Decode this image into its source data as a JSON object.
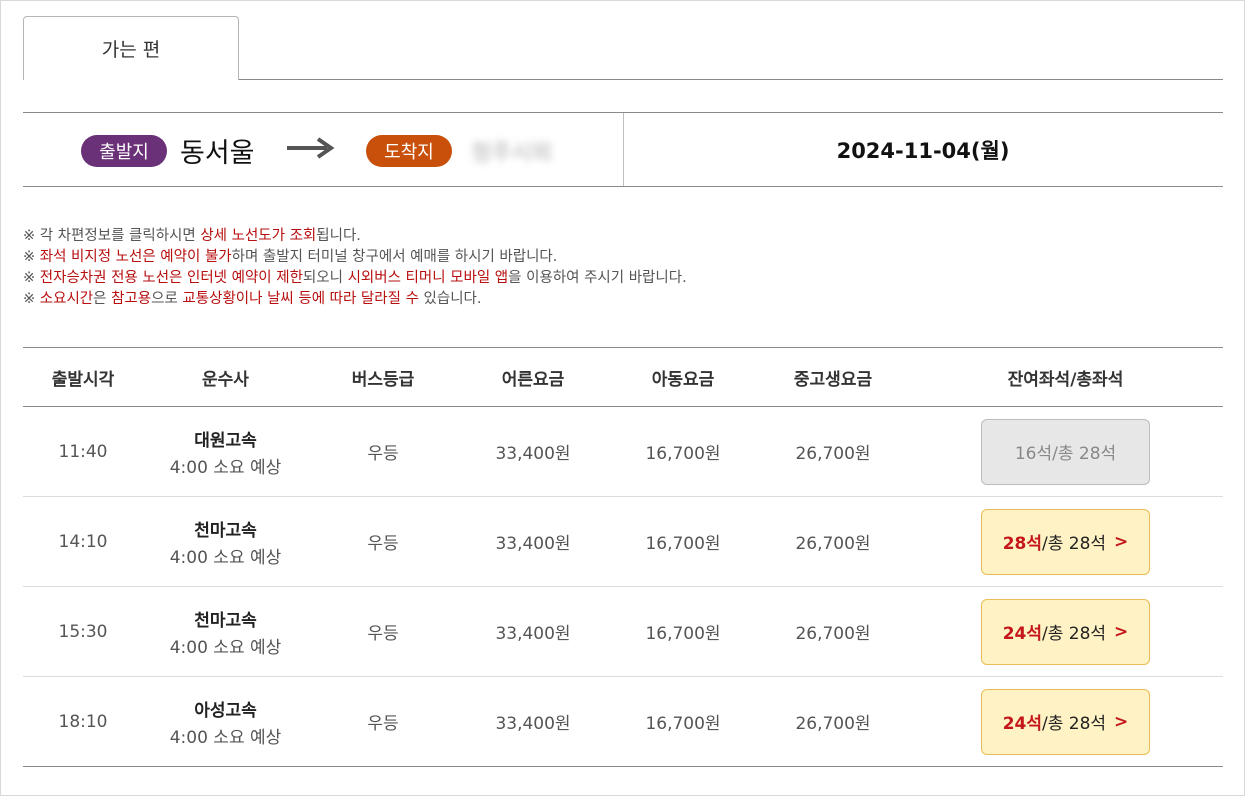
{
  "tabs": [
    {
      "label": "가는 편",
      "active": true
    }
  ],
  "route": {
    "departure_label": "출발지",
    "departure_city": "동서울",
    "arrival_label": "도착지",
    "arrival_city": "청주시외",
    "date": "2024-11-04(월)"
  },
  "notices": {
    "n1": {
      "a": "※ 각 차편정보를 클릭하시면 ",
      "b": "상세 노선도가 조회",
      "c": "됩니다."
    },
    "n2": {
      "a": "※ ",
      "b": "좌석 비지정 노선은 예약이 불가",
      "c": "하며 출발지 터미널 창구에서 예매를 하시기 바랍니다."
    },
    "n3": {
      "a": "※ ",
      "b": "전자승차권 전용 노선은 인터넷 예약이 제한",
      "c": "되오니 ",
      "d": "시외버스 티머니 모바일 앱",
      "e": "을 이용하여 주시기 바랍니다."
    },
    "n4": {
      "a": "※ ",
      "b": "소요시간",
      "c": "은 ",
      "d": "참고용",
      "e": "으로 ",
      "f": "교통상황이나 날씨 등에 따라 달라질 수",
      "g": " 있습니다."
    }
  },
  "table": {
    "headers": {
      "time": "출발시각",
      "company": "운수사",
      "grade": "버스등급",
      "adult": "어른요금",
      "child": "아동요금",
      "student": "중고생요금",
      "seats": "잔여좌석/총좌석"
    },
    "rows": [
      {
        "time": "11:40",
        "company": "대원고속",
        "duration": "4:00 소요 예상",
        "grade": "우등",
        "adult": "33,400원",
        "child": "16,700원",
        "student": "26,700원",
        "remaining": "16석",
        "total": " /총 28석",
        "available": false
      },
      {
        "time": "14:10",
        "company": "천마고속",
        "duration": "4:00 소요 예상",
        "grade": "우등",
        "adult": "33,400원",
        "child": "16,700원",
        "student": "26,700원",
        "remaining": "28석",
        "total": " /총 28석",
        "available": true
      },
      {
        "time": "15:30",
        "company": "천마고속",
        "duration": "4:00 소요 예상",
        "grade": "우등",
        "adult": "33,400원",
        "child": "16,700원",
        "student": "26,700원",
        "remaining": "24석",
        "total": " /총 28석",
        "available": true
      },
      {
        "time": "18:10",
        "company": "아성고속",
        "duration": "4:00 소요 예상",
        "grade": "우등",
        "adult": "33,400원",
        "child": "16,700원",
        "student": "26,700원",
        "remaining": "24석",
        "total": " /총 28석",
        "available": true
      }
    ]
  },
  "icons": {
    "arrow": "arrow-right-icon",
    "chevron": "chevron-right-icon"
  },
  "colors": {
    "departure": "#6a3178",
    "arrival": "#c9500a",
    "highlight": "#b80f0f",
    "seat_available_bg": "#fff2c4"
  }
}
